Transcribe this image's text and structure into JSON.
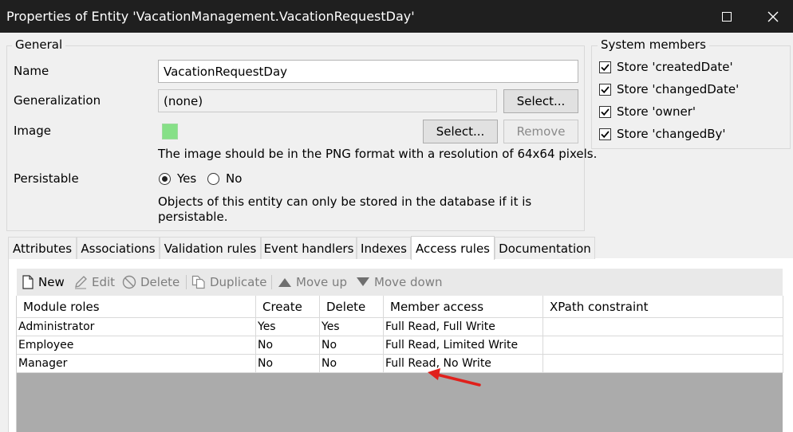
{
  "window": {
    "title": "Properties of Entity 'VacationManagement.VacationRequestDay'"
  },
  "general": {
    "legend": "General",
    "name_label": "Name",
    "name_value": "VacationRequestDay",
    "generalization_label": "Generalization",
    "generalization_value": "(none)",
    "generalization_select": "Select...",
    "image_label": "Image",
    "image_swatch_color": "#86e087",
    "image_select": "Select...",
    "image_remove": "Remove",
    "image_hint": "The image should be in the PNG format with a resolution of 64x64 pixels.",
    "persistable_label": "Persistable",
    "persistable_options": [
      {
        "label": "Yes",
        "selected": true
      },
      {
        "label": "No",
        "selected": false
      }
    ],
    "persistable_hint": "Objects of this entity can only be stored in the database if it is persistable."
  },
  "system_members": {
    "legend": "System members",
    "items": [
      {
        "label": "Store 'createdDate'",
        "checked": true
      },
      {
        "label": "Store 'changedDate'",
        "checked": true
      },
      {
        "label": "Store 'owner'",
        "checked": true
      },
      {
        "label": "Store 'changedBy'",
        "checked": true
      }
    ]
  },
  "tabs": [
    {
      "label": "Attributes",
      "active": false
    },
    {
      "label": "Associations",
      "active": false
    },
    {
      "label": "Validation rules",
      "active": false
    },
    {
      "label": "Event handlers",
      "active": false
    },
    {
      "label": "Indexes",
      "active": false
    },
    {
      "label": "Access rules",
      "active": true
    },
    {
      "label": "Documentation",
      "active": false
    }
  ],
  "toolbar": {
    "new": "New",
    "edit": "Edit",
    "delete": "Delete",
    "duplicate": "Duplicate",
    "move_up": "Move up",
    "move_down": "Move down"
  },
  "access_rules": {
    "columns": [
      "Module roles",
      "Create",
      "Delete",
      "Member access",
      "XPath constraint"
    ],
    "rows": [
      [
        "Administrator",
        "Yes",
        "Yes",
        "Full Read, Full Write",
        ""
      ],
      [
        "Employee",
        "No",
        "No",
        "Full Read, Limited Write",
        ""
      ],
      [
        "Manager",
        "No",
        "No",
        "Full Read, No Write",
        ""
      ]
    ]
  },
  "annotation": {
    "arrow_color": "#e0201b"
  }
}
